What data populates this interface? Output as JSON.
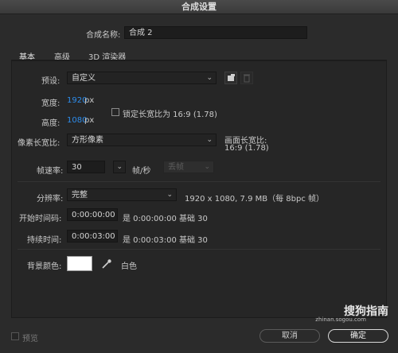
{
  "window": {
    "title": "合成设置"
  },
  "comp_name": {
    "label": "合成名称:",
    "value": "合成 2"
  },
  "tabs": [
    {
      "label": "基本",
      "active": true
    },
    {
      "label": "高级",
      "active": false
    },
    {
      "label": "3D 渲染器",
      "active": false
    }
  ],
  "preset": {
    "label": "预设:",
    "value": "自定义"
  },
  "width": {
    "label": "宽度:",
    "value": "1920",
    "unit": "px"
  },
  "height": {
    "label": "高度:",
    "value": "1080",
    "unit": "px"
  },
  "lock_aspect": {
    "label": "锁定长宽比为 16:9 (1.78)",
    "checked": false
  },
  "pixel_aspect": {
    "label": "像素长宽比:",
    "value": "方形像素"
  },
  "frame_aspect": {
    "label": "画面长宽比:",
    "value": "16:9 (1.78)"
  },
  "frame_rate": {
    "label": "帧速率:",
    "value": "30",
    "unit": "帧/秒",
    "drop_frame": "丢帧"
  },
  "resolution": {
    "label": "分辨率:",
    "value": "完整",
    "info": "1920 x 1080, 7.9 MB（每 8bpc 帧）"
  },
  "start_timecode": {
    "label": "开始时间码:",
    "value": "0:00:00:00",
    "info": "是 0:00:00:00 基础 30"
  },
  "duration": {
    "label": "持续时间:",
    "value": "0:00:03:00",
    "info": "是 0:00:03:00 基础 30"
  },
  "background": {
    "label": "背景颜色:",
    "color_name": "白色",
    "color": "#ffffff"
  },
  "footer": {
    "preview": "预览",
    "cancel": "取消",
    "ok": "确定"
  },
  "watermark": {
    "text": "搜狗指南",
    "sub": "zhinan.sogou.com"
  },
  "icons": [
    "chevron-down-icon",
    "new-preset-icon",
    "trash-icon",
    "eyedropper-icon",
    "checkbox-icon"
  ],
  "colors": {
    "accent_value": "#2d8ceb",
    "background": "#2b2b2b",
    "panel": "#262626"
  }
}
